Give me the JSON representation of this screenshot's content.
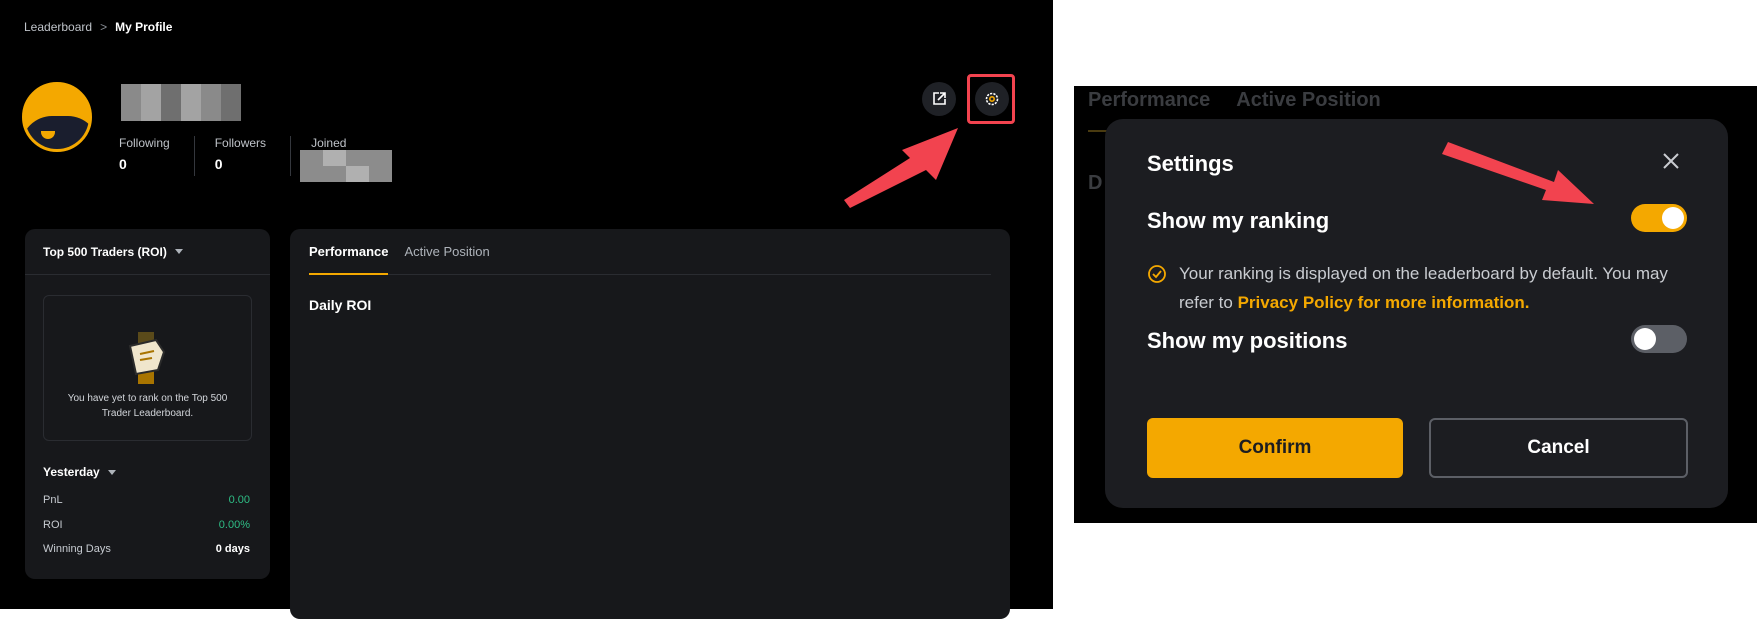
{
  "breadcrumb": {
    "parent": "Leaderboard",
    "separator": ">",
    "current": "My Profile"
  },
  "profile": {
    "stats": [
      {
        "label": "Following",
        "value": "0"
      },
      {
        "label": "Followers",
        "value": "0"
      },
      {
        "label": "Joined",
        "value": ""
      }
    ]
  },
  "ranking_panel": {
    "dropdown": "Top 500 Traders (ROI)",
    "empty_text": "You have yet to rank on the Top 500 Trader Leaderboard.",
    "period": "Yesterday",
    "metrics": [
      {
        "label": "PnL",
        "value": "0.00"
      },
      {
        "label": "ROI",
        "value": "0.00%"
      },
      {
        "label": "Winning Days",
        "value": "0 days"
      }
    ]
  },
  "main_panel": {
    "tabs": [
      "Performance",
      "Active Position"
    ],
    "section_title": "Daily ROI"
  },
  "settings_modal": {
    "bg_tabs": [
      "Performance",
      "Active Position"
    ],
    "bg_partial": "D",
    "title": "Settings",
    "show_ranking_label": "Show my ranking",
    "show_ranking_on": true,
    "note_text": "Your ranking is displayed on the leaderboard by default. You may refer to ",
    "note_link": "Privacy Policy for more information.",
    "show_positions_label": "Show my positions",
    "show_positions_on": false,
    "confirm_label": "Confirm",
    "cancel_label": "Cancel"
  },
  "colors": {
    "accent": "#f4a800",
    "positive": "#2ebd85",
    "annotation": "#f2434f",
    "panel_bg": "#17181b"
  }
}
